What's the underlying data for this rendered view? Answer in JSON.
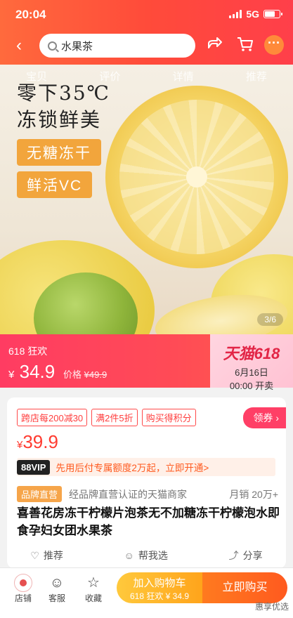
{
  "status_bar": {
    "time": "20:04",
    "network": "5G"
  },
  "header": {
    "search_value": "水果茶",
    "back_icon": "chevron-left-icon",
    "share_icon": "share-icon",
    "cart_icon": "cart-icon",
    "more_icon": "more-icon"
  },
  "hero": {
    "tabs": [
      "宝贝",
      "评价",
      "详情",
      "推荐"
    ],
    "line1": "零下35℃",
    "line2": "冻锁鲜美",
    "pill1": "无糖冻干",
    "pill2": "鲜活VC",
    "counter": "3/6"
  },
  "banner": {
    "promo": "618 狂欢",
    "currency": "¥",
    "price": "34.9",
    "orig_label": "价格",
    "orig_price": "¥49.9",
    "tmall": "天猫618",
    "date": "6月16日",
    "start": "00:00 开卖"
  },
  "card": {
    "coupons": [
      "跨店每200减30",
      "满2件5折",
      "购买得积分"
    ],
    "claim": "领券 ›",
    "currency": "¥",
    "price": "39.9",
    "vip_tag": "88VIP",
    "vip_text": "先用后付专属额度2万起，立即开通>",
    "brand_badge": "品牌直营",
    "brand_text": "经品牌直营认证的天猫商家",
    "sales": "月销 20万+",
    "title": "喜善花房冻干柠檬片泡茶无不加糖冻干柠檬泡水即食孕妇女团水果茶"
  },
  "actions": {
    "recommend": "推荐",
    "help_choose": "帮我选",
    "share": "分享"
  },
  "bottom": {
    "shop": "店铺",
    "service": "客服",
    "favorite": "收藏",
    "cart_l1": "加入购物车",
    "cart_l2": "618 狂欢 ¥ 34.9",
    "buy": "立即购买",
    "watermark": "惠享优选"
  },
  "colors": {
    "header": "#ff4b3a",
    "banner": "#ff3c62",
    "price": "#ff3b30",
    "buy": "#ff5a1f",
    "cart": "#ffa41b"
  }
}
